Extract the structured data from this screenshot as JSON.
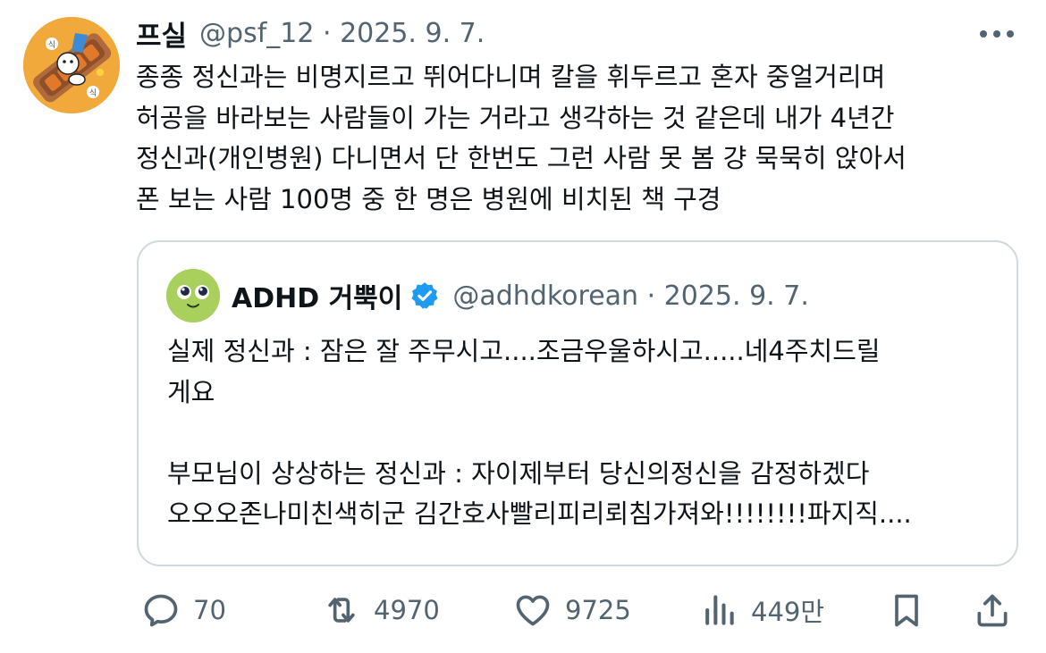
{
  "tweet": {
    "author": {
      "display_name": "프실",
      "meta": "@psf_12 · 2025. 9. 7.",
      "avatar_sticker_text": [
        "식",
        "식"
      ]
    },
    "text": "종종 정신과는 비명지르고 뛰어다니며 칼을 휘두르고 혼자 중얼거리며\n허공을 바라보는 사람들이 가는 거라고 생각하는 것 같은데 내가 4년간\n정신과(개인병원) 다니면서 단 한번도 그런 사람 못 봄 걍 묵묵히 앉아서\n폰 보는 사람 100명 중 한 명은 병원에 비치된 책 구경",
    "more_icon": "more-horizontal-icon"
  },
  "quote": {
    "author": {
      "display_name": "ADHD 거뿍이",
      "meta": "@adhdkorean · 2025. 9. 7.",
      "verified_icon": "verified-badge-icon"
    },
    "text": "실제 정신과 : 잠은 잘 주무시고....조금우울하시고.....네4주치드릴\n게요\n\n부모님이 상상하는 정신과 : 자이제부터 당신의정신을 감정하겠다\n오오오존나미친색히군 김간호사빨리피리뢰침가져와!!!!!!!!파지직...."
  },
  "actions": {
    "reply": {
      "icon": "reply-icon",
      "count": "70"
    },
    "retweet": {
      "icon": "retweet-icon",
      "count": "4970"
    },
    "like": {
      "icon": "heart-icon",
      "count": "9725"
    },
    "views": {
      "icon": "views-icon",
      "count": "449만"
    },
    "bookmark": {
      "icon": "bookmark-icon"
    },
    "share": {
      "icon": "share-icon"
    }
  },
  "colors": {
    "text_primary": "#0f1419",
    "text_secondary": "#536471",
    "border": "#cfd9de",
    "verified_blue": "#1d9bf0",
    "avatar_bg": "#f2a93b",
    "quote_avatar_bg": "#a9cf5c"
  }
}
